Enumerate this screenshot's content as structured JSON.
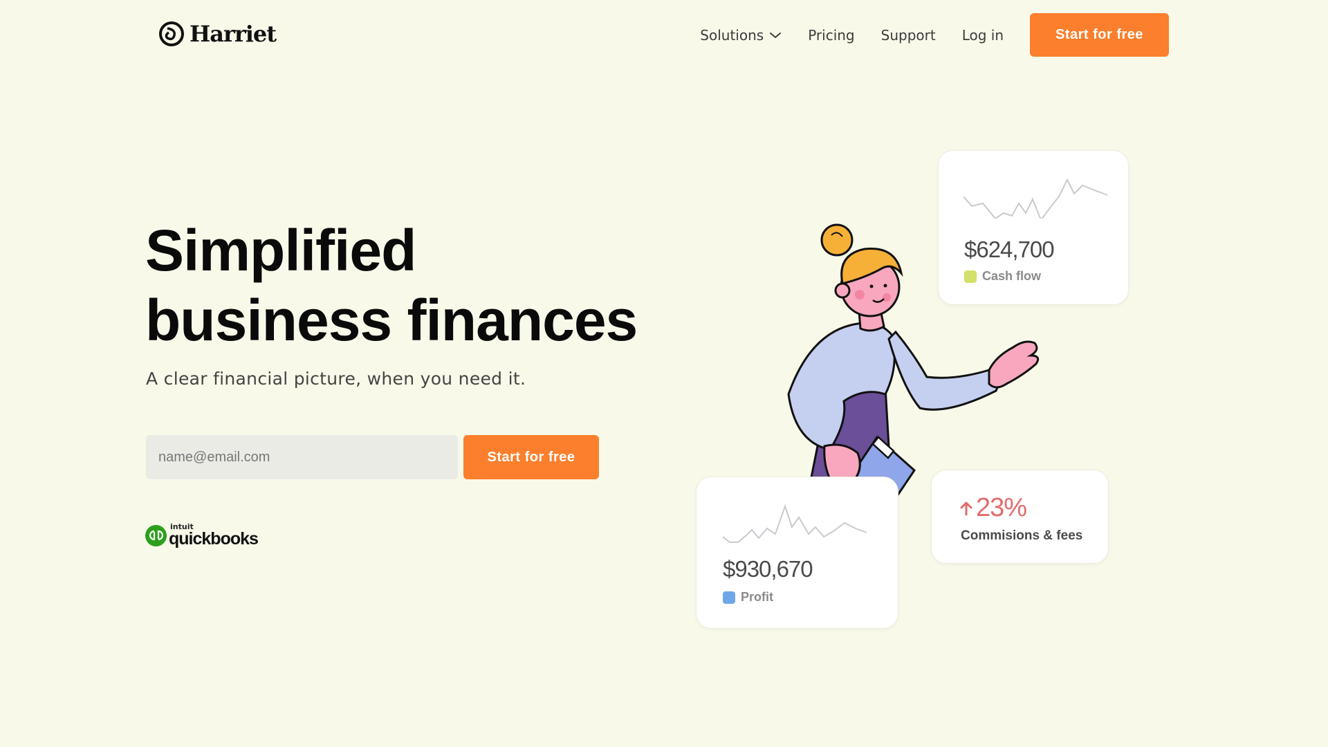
{
  "header": {
    "logo_text": "Harriet",
    "nav": {
      "solutions": "Solutions",
      "pricing": "Pricing",
      "support": "Support",
      "login": "Log in",
      "cta": "Start for free"
    }
  },
  "hero": {
    "headline_line1": "Simplified",
    "headline_line2": "business finances",
    "subheadline": "A clear financial picture, when you need it.",
    "email_placeholder": "name@email.com",
    "cta": "Start for free",
    "partner": {
      "intuit": "intuit",
      "name": "quickbooks"
    }
  },
  "cards": {
    "cash_flow": {
      "value": "$624,700",
      "label": "Cash flow",
      "color": "#d3e06a"
    },
    "profit": {
      "value": "$930,670",
      "label": "Profit",
      "color": "#6fa6e8"
    },
    "commissions": {
      "value": "23%",
      "label": "Commisions & fees",
      "color": "#e26b6b"
    }
  },
  "colors": {
    "background": "#f9f9ea",
    "accent": "#fb7f2c",
    "quickbooks_green": "#2ca01c"
  },
  "icons": [
    "harriet-logo-icon",
    "chevron-down-icon",
    "quickbooks-logo-icon",
    "arrow-up-icon"
  ]
}
